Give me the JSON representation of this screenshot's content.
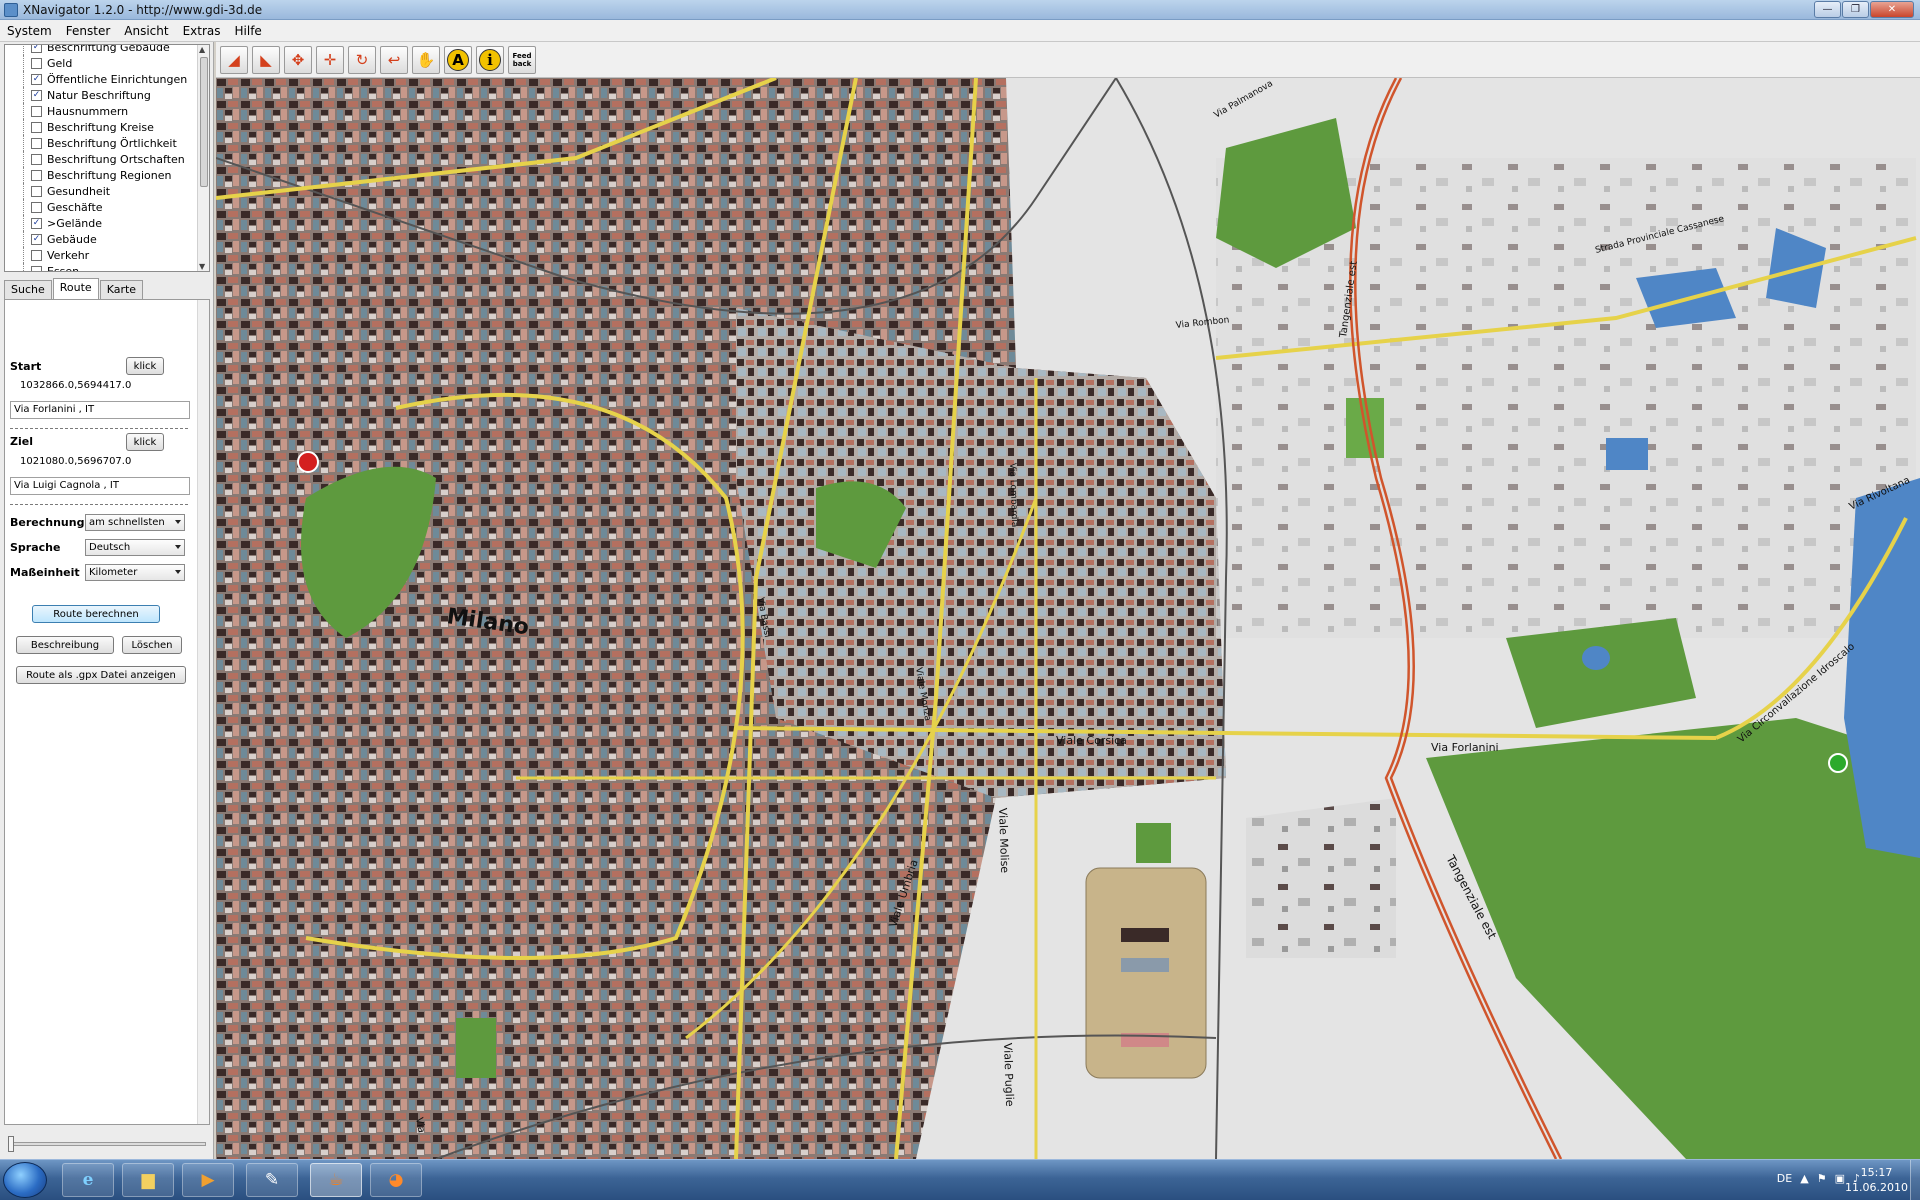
{
  "window": {
    "title": "XNavigator 1.2.0 - http://www.gdi-3d.de"
  },
  "menu": [
    "System",
    "Fenster",
    "Ansicht",
    "Extras",
    "Hilfe"
  ],
  "layers": [
    {
      "label": "Beschriftung Gebäude",
      "checked": true
    },
    {
      "label": "Geld",
      "checked": false
    },
    {
      "label": "Öffentliche Einrichtungen",
      "checked": true
    },
    {
      "label": "Natur Beschriftung",
      "checked": true
    },
    {
      "label": "Hausnummern",
      "checked": false
    },
    {
      "label": "Beschriftung Kreise",
      "checked": false
    },
    {
      "label": "Beschriftung Örtlichkeit",
      "checked": false
    },
    {
      "label": "Beschriftung Ortschaften",
      "checked": false
    },
    {
      "label": "Beschriftung Regionen",
      "checked": false
    },
    {
      "label": "Gesundheit",
      "checked": false
    },
    {
      "label": "Geschäfte",
      "checked": false
    },
    {
      "label": ">Gelände",
      "checked": true
    },
    {
      "label": "Gebäude",
      "checked": true
    },
    {
      "label": "Verkehr",
      "checked": false
    },
    {
      "label": "Essen",
      "checked": false
    }
  ],
  "tabs": [
    "Suche",
    "Route",
    "Karte"
  ],
  "route": {
    "start_label": "Start",
    "start_button": "klick",
    "start_coords": "1032866.0,5694417.0",
    "start_address": "Via Forlanini , IT",
    "ziel_label": "Ziel",
    "ziel_button": "klick",
    "ziel_coords": "1021080.0,5696707.0",
    "ziel_address": "Via Luigi Cagnola , IT",
    "berechnung_label": "Berechnung",
    "berechnung_value": "am schnellsten",
    "sprache_label": "Sprache",
    "sprache_value": "Deutsch",
    "masseinheit_label": "Maßeinheit",
    "masseinheit_value": "Kilometer",
    "calc_button": "Route berechnen",
    "desc_button": "Beschreibung",
    "delete_button": "Löschen",
    "gpx_button": "Route als .gpx Datei anzeigen"
  },
  "toolbar": {
    "feedback_line1": "Feed",
    "feedback_line2": "back",
    "text_tool": "A",
    "info_tool": "i"
  },
  "map": {
    "labels": {
      "milano": "Milano",
      "via_forlanini": "Via Forlanini",
      "viale_corsica": "Viale Corsica",
      "viale_molise": "Viale Molise",
      "viale_puglie": "Viale Puglie",
      "tangenziale_est": "Tangenziale est",
      "tangenziale_est_north": "Tangenziale est",
      "via_circonvallazione_idroscalo": "Via Circonvallazione Idroscalo",
      "via_rivoltana": "Via Rivoltana",
      "strada_provinciale": "Strada Provinciale Cassanese",
      "via_rombon": "Via Rombon",
      "via_palmanova": "Via Palmanova",
      "viale_umbria": "Viale Umbria",
      "via_lombardia": "Via Lombardia",
      "viale_monza": "Viale Monza",
      "via_bassi": "Via Bassi",
      "via_left": "Via"
    },
    "colors": {
      "terrain": "#e4e4e4",
      "park": "#5e9a3e",
      "water": "#4f86c6",
      "road_major": "#e6d24a",
      "motorway": "#d0552c",
      "building_dark": "#3a2a28",
      "building_red": "#b47060"
    }
  },
  "taskbar": {
    "language": "DE",
    "time": "15:17",
    "date": "11.06.2010"
  }
}
